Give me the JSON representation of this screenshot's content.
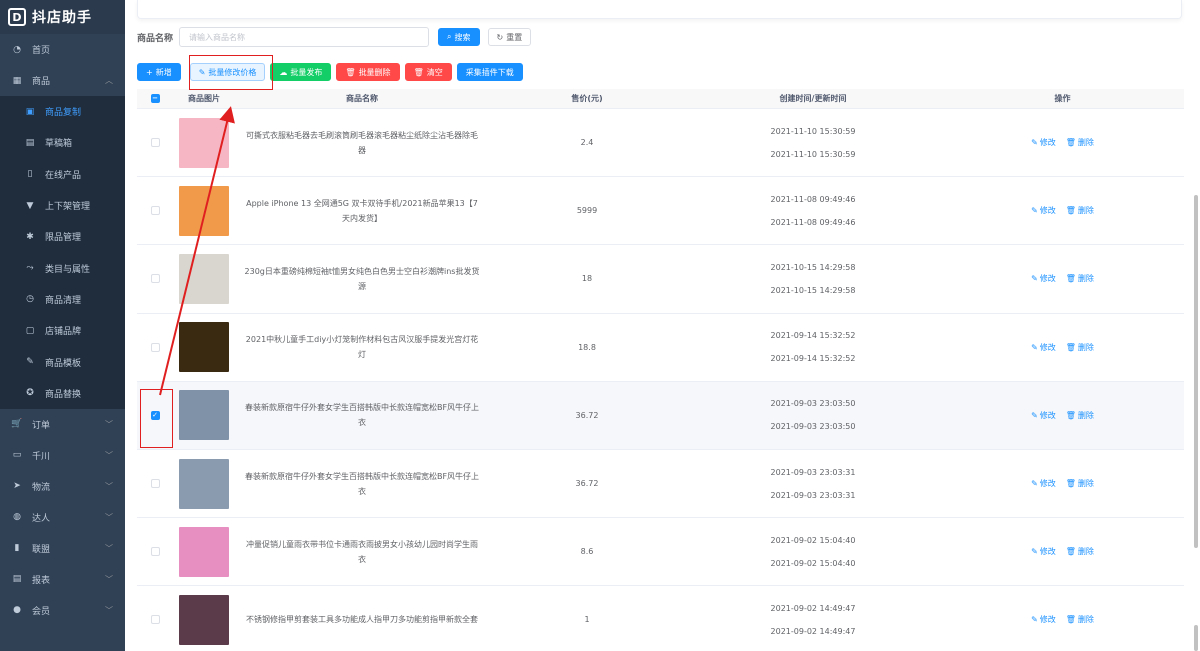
{
  "app": {
    "logo_letter": "D",
    "title": "抖店助手"
  },
  "sidebar": {
    "items": [
      {
        "label": "首页",
        "icon": "dashboard-icon",
        "glyph": "◔"
      },
      {
        "label": "商品",
        "icon": "grid-icon",
        "glyph": "▦",
        "expanded": true
      },
      {
        "label": "订单",
        "icon": "cart-icon",
        "glyph": "🛒"
      },
      {
        "label": "千川",
        "icon": "monitor-icon",
        "glyph": "▭"
      },
      {
        "label": "物流",
        "icon": "send-icon",
        "glyph": "➤"
      },
      {
        "label": "达人",
        "icon": "globe-icon",
        "glyph": "◍"
      },
      {
        "label": "联盟",
        "icon": "bar-chart-icon",
        "glyph": "▮"
      },
      {
        "label": "报表",
        "icon": "report-icon",
        "glyph": "▤"
      },
      {
        "label": "会员",
        "icon": "user-icon",
        "glyph": "●"
      }
    ],
    "sub_items": [
      {
        "label": "商品复制",
        "icon": "copy-icon",
        "glyph": "▣",
        "active": true
      },
      {
        "label": "草稿箱",
        "icon": "draft-icon",
        "glyph": "▤"
      },
      {
        "label": "在线产品",
        "icon": "document-icon",
        "glyph": "▯"
      },
      {
        "label": "上下架管理",
        "icon": "cart-icon",
        "glyph": "▼"
      },
      {
        "label": "限品管理",
        "icon": "gear-icon",
        "glyph": "✱"
      },
      {
        "label": "类目与属性",
        "icon": "share-icon",
        "glyph": "⤳"
      },
      {
        "label": "商品清理",
        "icon": "clock-icon",
        "glyph": "◷"
      },
      {
        "label": "店铺品牌",
        "icon": "tag-icon",
        "glyph": "▢"
      },
      {
        "label": "商品模板",
        "icon": "edit-icon",
        "glyph": "✎"
      },
      {
        "label": "商品替换",
        "icon": "refresh-icon",
        "glyph": "✪"
      }
    ]
  },
  "search": {
    "label": "商品名称",
    "placeholder": "请输入商品名称",
    "search_btn": "搜索",
    "reset_btn": "重置"
  },
  "actions": {
    "add": "新增",
    "batch_edit_price": "批量修改价格",
    "batch_publish": "批量发布",
    "batch_delete": "批量删除",
    "clear": "清空",
    "download_plugin": "采集插件下载"
  },
  "table": {
    "headers": {
      "image": "商品图片",
      "name": "商品名称",
      "price": "售价(元)",
      "time": "创建时间/更新时间",
      "ops": "操作"
    },
    "edit_label": "修改",
    "delete_label": "删除",
    "rows": [
      {
        "name": "可撕式衣服粘毛器去毛刷滚筒刷毛器滚毛器粘尘纸除尘沾毛器除毛器",
        "price": "2.4",
        "created": "2021-11-10 15:30:59",
        "updated": "2021-11-10 15:30:59",
        "checked": false,
        "thumb": "#f7b6c4"
      },
      {
        "name": "Apple iPhone 13 全网通5G 双卡双待手机/2021新品苹果13【7天内发货】",
        "price": "5999",
        "created": "2021-11-08 09:49:46",
        "updated": "2021-11-08 09:49:46",
        "checked": false,
        "thumb": "#f19a4a"
      },
      {
        "name": "230g日本重磅纯棉短袖t恤男女纯色白色男士空白衫潮牌ins批发货源",
        "price": "18",
        "created": "2021-10-15 14:29:58",
        "updated": "2021-10-15 14:29:58",
        "checked": false,
        "thumb": "#d9d5cf"
      },
      {
        "name": "2021中秋儿童手工diy小灯笼制作材料包古风汉服手提发光宫灯花灯",
        "price": "18.8",
        "created": "2021-09-14 15:32:52",
        "updated": "2021-09-14 15:32:52",
        "checked": false,
        "thumb": "#3a2a12"
      },
      {
        "name": "春装新款原宿牛仔外套女学生百搭韩版中长款连帽宽松BF风牛仔上衣",
        "price": "36.72",
        "created": "2021-09-03 23:03:50",
        "updated": "2021-09-03 23:03:50",
        "checked": true,
        "thumb": "#7f92a8"
      },
      {
        "name": "春装新款原宿牛仔外套女学生百搭韩版中长款连帽宽松BF风牛仔上衣",
        "price": "36.72",
        "created": "2021-09-03 23:03:31",
        "updated": "2021-09-03 23:03:31",
        "checked": false,
        "thumb": "#8a9bb0"
      },
      {
        "name": "冲量促销儿童雨衣带书位卡通雨衣雨披男女小孩幼儿园时尚学生雨衣",
        "price": "8.6",
        "created": "2021-09-02 15:04:40",
        "updated": "2021-09-02 15:04:40",
        "checked": false,
        "thumb": "#e88fc2"
      },
      {
        "name": "不锈钢修指甲剪套装工具多功能成人指甲刀多功能剪指甲新款全套",
        "price": "1",
        "created": "2021-09-02 14:49:47",
        "updated": "2021-09-02 14:49:47",
        "checked": false,
        "thumb": "#5b3a4a"
      }
    ]
  },
  "colors": {
    "primary": "#1890ff",
    "success": "#13ce66",
    "danger": "#ff4949",
    "sidebar": "#304156",
    "annotation": "#e02020"
  }
}
